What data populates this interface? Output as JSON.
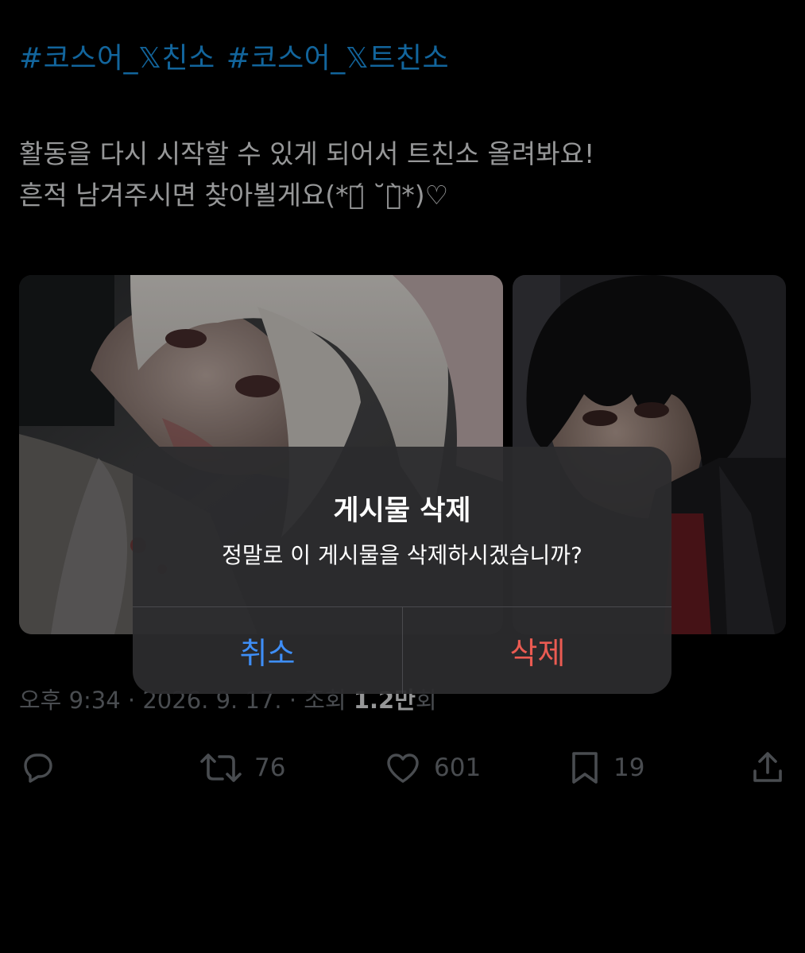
{
  "tweet": {
    "hashtags": [
      "#코스어_𝕏친소",
      "#코스어_𝕏트친소"
    ],
    "lines": [
      "활동을 다시 시작할 수 있게 되어서 트친소 올려봐요!",
      "흔적 남겨주시면 찾아뵐게요(*ต́ ˘ต̀*)♡"
    ],
    "meta": {
      "time": "오후 9:34 · 2026. 9. 17. · 조회 ",
      "views": "1.2만",
      "views_suffix": "회"
    }
  },
  "actions": {
    "reply": {
      "icon": "reply-icon"
    },
    "retweet": {
      "icon": "retweet-icon",
      "count": "76"
    },
    "like": {
      "icon": "heart-icon",
      "count": "601"
    },
    "bookmark": {
      "icon": "bookmark-icon",
      "count": "19"
    },
    "share": {
      "icon": "share-icon"
    }
  },
  "dialog": {
    "title": "게시물 삭제",
    "message": "정말로 이 게시물을 삭제하시겠습니까?",
    "cancel_label": "취소",
    "delete_label": "삭제"
  },
  "colors": {
    "background": "#000000",
    "link": "#1d9bf0",
    "muted": "#71767b",
    "dialog_cancel": "#3e8ef7",
    "dialog_delete": "#eb5b52"
  }
}
